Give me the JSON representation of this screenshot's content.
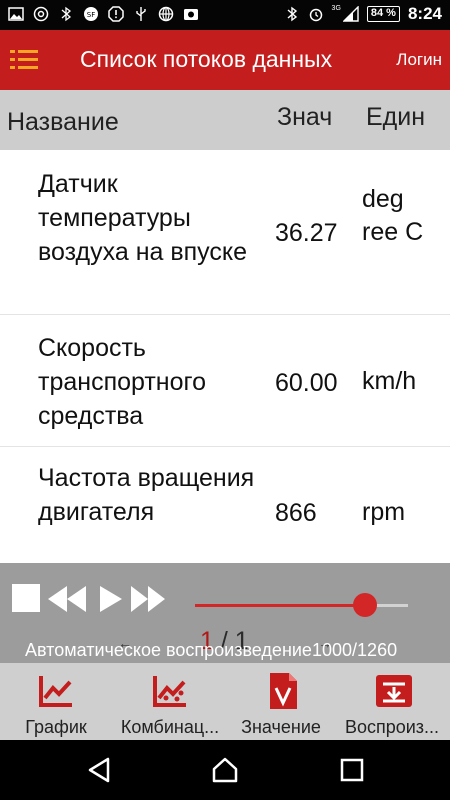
{
  "status_bar": {
    "icons": [
      "image-icon",
      "at-icon",
      "bluetooth-icon",
      "sf-icon",
      "alert-icon",
      "usb-icon",
      "globe-icon",
      "photo-icon"
    ],
    "right_icons": [
      "bluetooth-icon",
      "alarm-icon",
      "signal-icon"
    ],
    "network": "3G",
    "battery": "84 %",
    "time": "8:24"
  },
  "appbar": {
    "title": "Список потоков данных",
    "login": "Логин"
  },
  "table": {
    "headers": {
      "name": "Название",
      "value": "Знач",
      "unit": "Един"
    },
    "rows": [
      {
        "name": "Датчик температуры воздуха на впуске",
        "value": "36.27",
        "unit": "deg ree C"
      },
      {
        "name": "Скорость транспортного средства",
        "value": "60.00",
        "unit": "km/h"
      },
      {
        "name": "Частота вращения двигателя",
        "value": "866",
        "unit": "rpm"
      }
    ]
  },
  "player": {
    "progress": 0.8,
    "page_current": "1",
    "page_separator": "/",
    "page_total": "1",
    "status": "Автоматическое воспроизведение",
    "count": "1000/1260"
  },
  "tabs": [
    {
      "label": "График",
      "icon": "chart-icon"
    },
    {
      "label": "Комбинац...",
      "icon": "combination-chart-icon"
    },
    {
      "label": "Значение",
      "icon": "value-document-icon"
    },
    {
      "label": "Воспроиз...",
      "icon": "playback-icon"
    }
  ],
  "colors": {
    "accent": "#c31d1d",
    "menu_icon": "#f6a623",
    "header_bg": "#cdcdcd",
    "player_bg": "#9c9c9c",
    "tabbar_bg": "#cfcfcf"
  }
}
